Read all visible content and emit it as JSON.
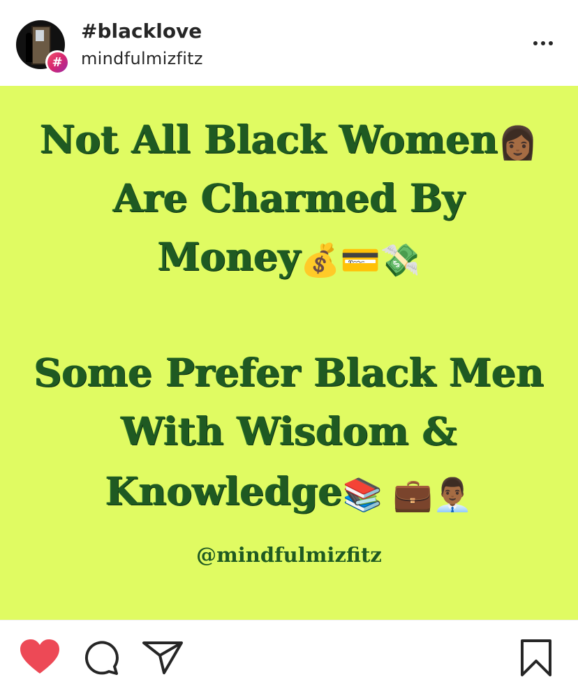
{
  "header": {
    "title": "#blacklove",
    "username": "mindfulmizfitz",
    "badge_symbol": "#",
    "more_icon": "ellipsis-icon"
  },
  "post": {
    "background_color": "#e0fb62",
    "text_color": "#1f5a22",
    "lines": [
      {
        "text": "Not All Black Women",
        "emoji": "👩🏾"
      },
      {
        "text": "Are Charmed By",
        "emoji": ""
      },
      {
        "text": "Money",
        "emoji": "💰💳💸"
      },
      {
        "text": "Some Prefer Black Men",
        "emoji": ""
      },
      {
        "text": "With Wisdom &",
        "emoji": ""
      },
      {
        "text": "Knowledge",
        "emoji": "📚 💼👨🏾‍💼"
      }
    ],
    "handle": "@mindfulmizfitz"
  },
  "actions": {
    "like_icon": "heart-icon",
    "like_color": "#ed4956",
    "comment_icon": "comment-icon",
    "share_icon": "send-icon",
    "save_icon": "bookmark-icon"
  }
}
